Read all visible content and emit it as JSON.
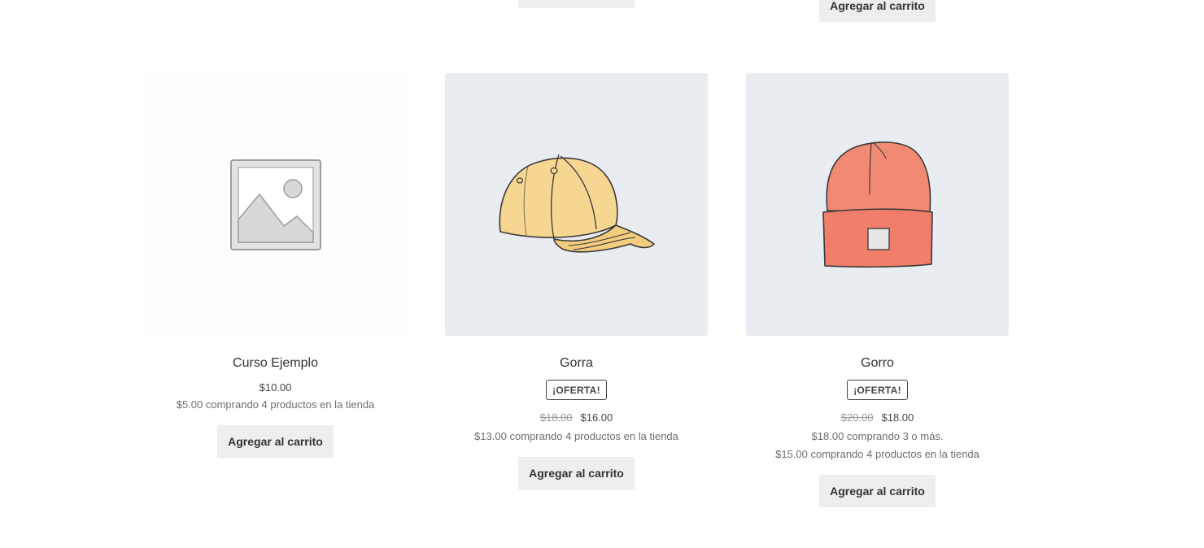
{
  "previous_row": {
    "right_button_label": "Agregar al carrito"
  },
  "products": [
    {
      "title": "Curso Ejemplo",
      "image_icon": "image-placeholder-icon",
      "price": "$10.00",
      "bulk_lines": [
        "$5.00 comprando 4 productos en la tienda"
      ],
      "button": "Agregar al carrito"
    },
    {
      "title": "Gorra",
      "badge": "¡OFERTA!",
      "old_price": "$18.00",
      "price": "$16.00",
      "bulk_lines": [
        "$13.00 comprando 4 productos en la tienda"
      ],
      "button": "Agregar al carrito"
    },
    {
      "title": "Gorro",
      "badge": "¡OFERTA!",
      "old_price": "$20.00",
      "price": "$18.00",
      "bulk_lines": [
        "$18.00 comprando 3 o más.",
        "$15.00 comprando 4 productos en la tienda"
      ],
      "button": "Agregar al carrito"
    }
  ],
  "colors": {
    "thumb_bg": "#e9edf2",
    "button_bg": "#eeeeee",
    "cap": "#f6d690",
    "beanie": "#f28a73"
  }
}
